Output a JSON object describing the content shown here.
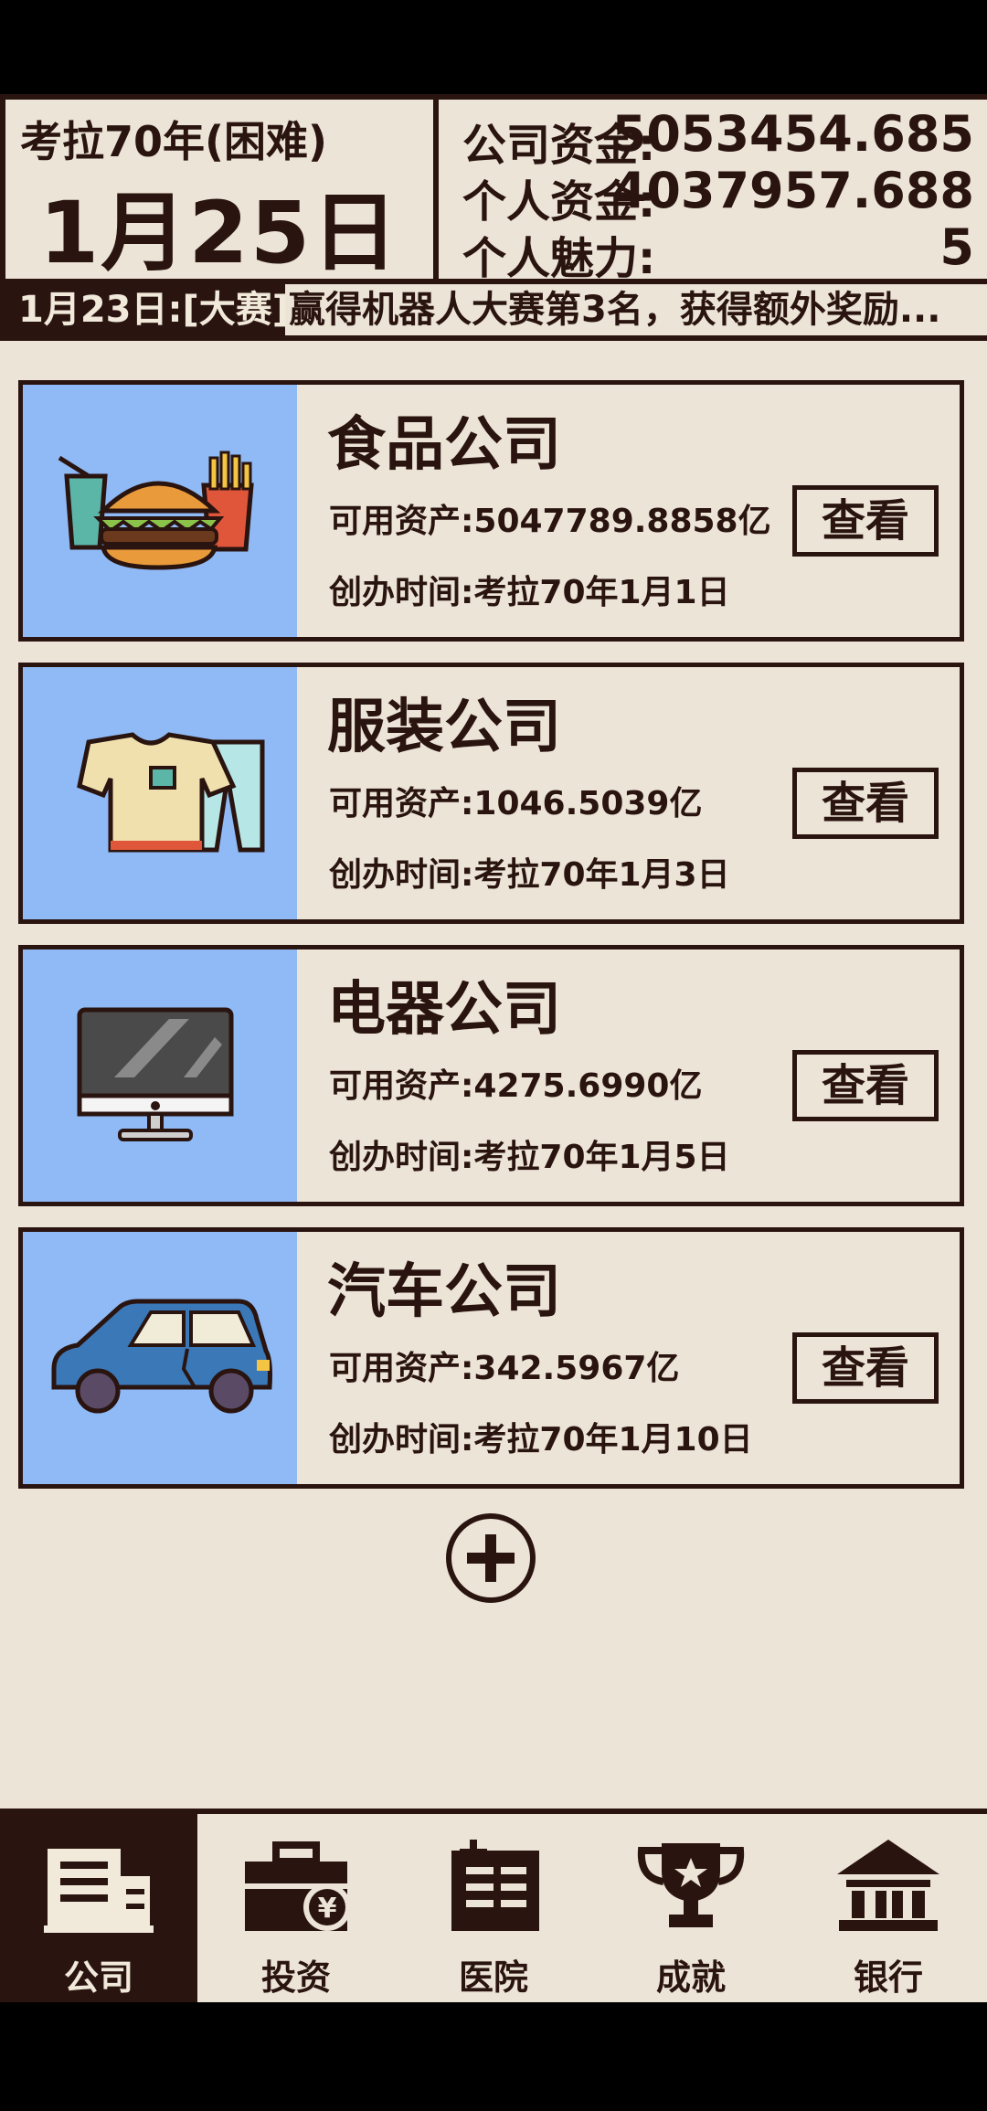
{
  "header": {
    "year_label": "考拉70年(困难)",
    "date": "1月25日",
    "stats": [
      {
        "label": "公司资金:",
        "value": "5053454.685"
      },
      {
        "label": "个人资金:",
        "value": "4037957.688"
      },
      {
        "label": "个人魅力:",
        "value": "5"
      }
    ]
  },
  "ticker": {
    "date": "1月23日:[大赛]",
    "text": "赢得机器人大赛第3名，获得额外奖励..."
  },
  "companies": [
    {
      "name": "食品公司",
      "assets": "可用资产:5047789.8858亿",
      "founded": "创办时间:考拉70年1月1日",
      "button": "查看",
      "icon": "food-icon"
    },
    {
      "name": "服装公司",
      "assets": "可用资产:1046.5039亿",
      "founded": "创办时间:考拉70年1月3日",
      "button": "查看",
      "icon": "clothing-icon"
    },
    {
      "name": "电器公司",
      "assets": "可用资产:4275.6990亿",
      "founded": "创办时间:考拉70年1月5日",
      "button": "查看",
      "icon": "monitor-icon"
    },
    {
      "name": "汽车公司",
      "assets": "可用资产:342.5967亿",
      "founded": "创办时间:考拉70年1月10日",
      "button": "查看",
      "icon": "car-icon"
    }
  ],
  "add_button": {
    "icon": "plus-circle-icon"
  },
  "nav": {
    "items": [
      {
        "label": "公司",
        "icon": "building-icon",
        "active": true
      },
      {
        "label": "投资",
        "icon": "briefcase-yen-icon",
        "active": false
      },
      {
        "label": "医院",
        "icon": "hospital-icon",
        "active": false
      },
      {
        "label": "成就",
        "icon": "trophy-icon",
        "active": false
      },
      {
        "label": "银行",
        "icon": "bank-icon",
        "active": false
      }
    ]
  },
  "colors": {
    "ink": "#2a1410",
    "paper": "#ece4d6",
    "card_image_bg": "#8fbaf6"
  }
}
